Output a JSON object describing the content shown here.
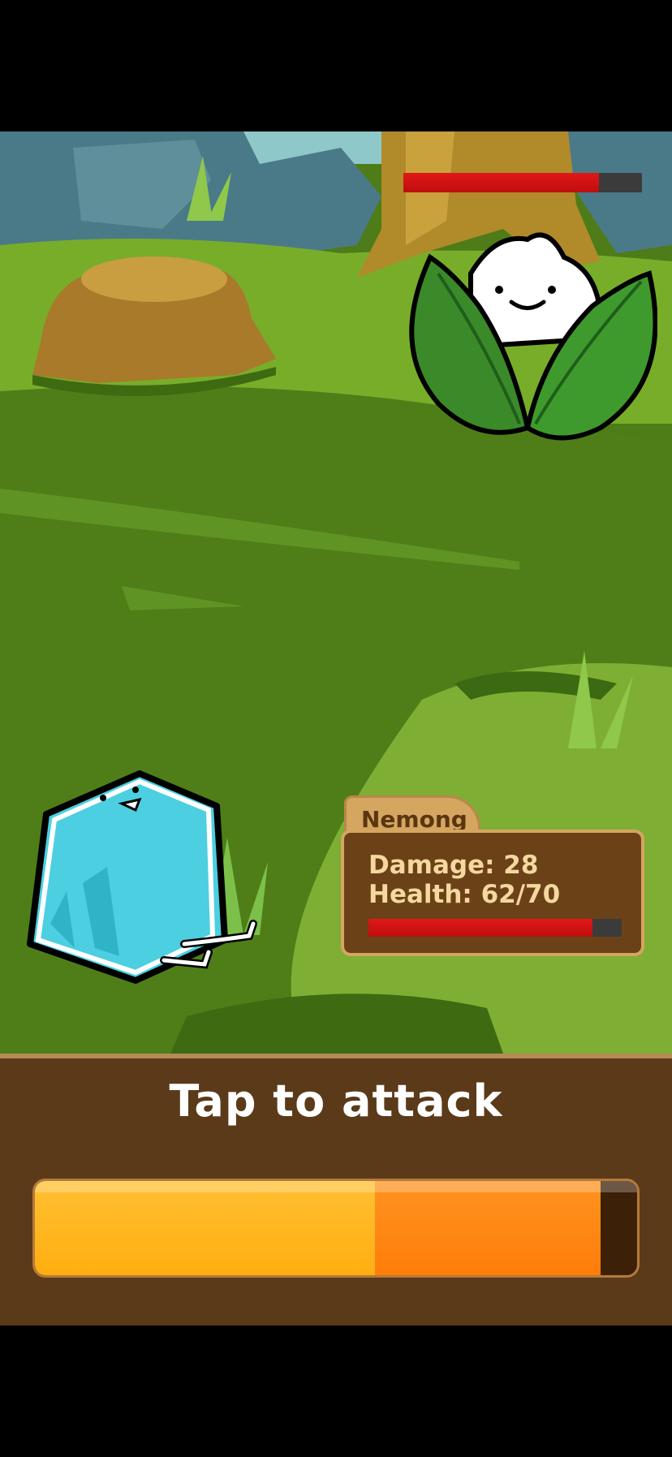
{
  "enemy": {
    "health_fraction": 0.82,
    "art_icon": "leaf-sprout-creature"
  },
  "player": {
    "art_icon": "ice-cube-creature"
  },
  "info_panel": {
    "name": "Nemong",
    "damage_text": "Damage: 28",
    "health_text": "Health: 62/70",
    "health_current": 62,
    "health_max": 70
  },
  "attack_panel": {
    "label": "Tap to attack",
    "charge_fraction": 0.565,
    "bonus_fraction": 0.375
  },
  "colors": {
    "hp_fill": "#d01010",
    "attack_base": "#ffb01a",
    "attack_bonus": "#ff8510",
    "panel_wood": "#5b3a1a"
  }
}
